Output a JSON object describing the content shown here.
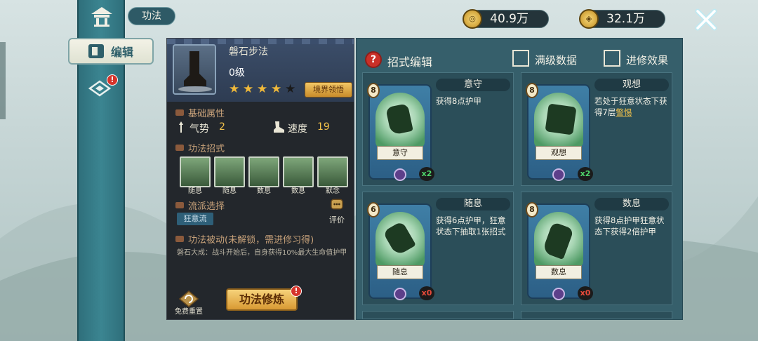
{
  "header": {
    "title": "功法",
    "currency_silver": "40.9万",
    "currency_gold": "32.1万",
    "silver_icon": "coin-silver-icon",
    "gold_icon": "coin-gold-icon"
  },
  "sidebar": {
    "edit_label": "编辑",
    "notif_badge": "!"
  },
  "technique": {
    "name": "磐石步法",
    "level": "0级",
    "stars_filled": 4,
    "stars_total": 5,
    "realm_button": "境界领悟",
    "section_base": "基础属性",
    "stat1_label": "气势",
    "stat1_value": "2",
    "stat2_label": "速度",
    "stat2_value": "19",
    "section_moves": "功法招式",
    "moves": [
      "随息",
      "随息",
      "数息",
      "数息",
      "默念"
    ],
    "section_school": "流派选择",
    "school_tag": "狂意流",
    "eval_label": "评价",
    "section_passive": "功法被动(未解锁，需进修习得)",
    "passive_desc": "磐石大成：战斗开始后，自身获得10%最大生命值护甲",
    "reset_label": "免费重置",
    "train_button": "功法修炼",
    "train_badge": "!"
  },
  "moves_panel": {
    "help": "?",
    "title": "招式编辑",
    "check1_label": "满级数据",
    "check2_label": "进修效果",
    "cards": [
      {
        "title": "意守",
        "scroll": "意守",
        "cost": "8",
        "count": "x2",
        "count_color": "green",
        "desc": "获得8点护甲",
        "desc_hl": ""
      },
      {
        "title": "观想",
        "scroll": "观想",
        "cost": "8",
        "count": "x2",
        "count_color": "green",
        "desc": "若处于狂意状态下获得7层",
        "desc_hl": "警惕"
      },
      {
        "title": "随息",
        "scroll": "随息",
        "cost": "6",
        "count": "x0",
        "count_color": "red",
        "desc": "获得6点护甲，狂意状态下抽取1张招式",
        "desc_hl": ""
      },
      {
        "title": "数息",
        "scroll": "数息",
        "cost": "8",
        "count": "x0",
        "count_color": "red",
        "desc": "获得8点护甲狂意状态下获得2倍护甲",
        "desc_hl": ""
      }
    ]
  },
  "colors": {
    "accent_gold": "#f2c14a",
    "panel_teal": "#365f6b",
    "badge_red": "#d6342b"
  }
}
